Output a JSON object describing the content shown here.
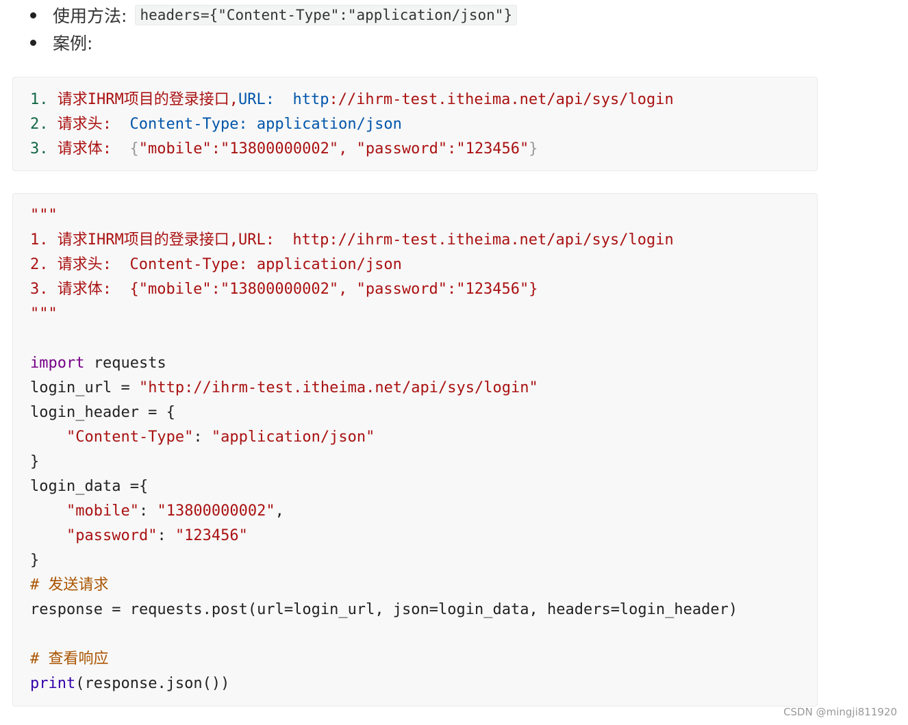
{
  "bullets": [
    {
      "label": "使用方法:",
      "code": "headers={\"Content-Type\":\"application/json\"}"
    },
    {
      "label": "案例:",
      "code": ""
    }
  ],
  "block1": {
    "lines": [
      [
        {
          "t": "1. ",
          "c": "num"
        },
        {
          "t": "请求IHRM项目的登录接口,",
          "c": "str"
        },
        {
          "t": "URL: ",
          "c": "meta"
        },
        {
          "t": " http",
          "c": "meta"
        },
        {
          "t": "://ihrm-test.itheima.net/api/sys/login",
          "c": "str"
        }
      ],
      [
        {
          "t": "2. ",
          "c": "num"
        },
        {
          "t": "请求头: ",
          "c": "str"
        },
        {
          "t": " Content-Type: application/json",
          "c": "meta"
        }
      ],
      [
        {
          "t": "3. ",
          "c": "num"
        },
        {
          "t": "请求体: ",
          "c": "str"
        },
        {
          "t": " {",
          "c": "punct"
        },
        {
          "t": "\"mobile\":\"13800000002\", \"password\":\"123456\"",
          "c": "str"
        },
        {
          "t": "}",
          "c": "punct"
        }
      ]
    ]
  },
  "block2": {
    "lines": [
      [
        {
          "t": "\"\"\"",
          "c": "str"
        }
      ],
      [
        {
          "t": "1. 请求IHRM项目的登录接口,URL:  http://ihrm-test.itheima.net/api/sys/login",
          "c": "str"
        }
      ],
      [
        {
          "t": "2. 请求头:  Content-Type: application/json",
          "c": "str"
        }
      ],
      [
        {
          "t": "3. 请求体:  {\"mobile\":\"13800000002\", \"password\":\"123456\"}",
          "c": "str"
        }
      ],
      [
        {
          "t": "\"\"\"",
          "c": "str"
        }
      ],
      [],
      [
        {
          "t": "import",
          "c": "kw"
        },
        {
          "t": " requests",
          "c": "default"
        }
      ],
      [
        {
          "t": "login_url = ",
          "c": "default"
        },
        {
          "t": "\"http://ihrm-test.itheima.net/api/sys/login\"",
          "c": "str"
        }
      ],
      [
        {
          "t": "login_header = {",
          "c": "default"
        }
      ],
      [
        {
          "t": "    ",
          "c": "default"
        },
        {
          "t": "\"Content-Type\"",
          "c": "str"
        },
        {
          "t": ": ",
          "c": "default"
        },
        {
          "t": "\"application/json\"",
          "c": "str"
        }
      ],
      [
        {
          "t": "}",
          "c": "default"
        }
      ],
      [
        {
          "t": "login_data ={",
          "c": "default"
        }
      ],
      [
        {
          "t": "    ",
          "c": "default"
        },
        {
          "t": "\"mobile\"",
          "c": "str"
        },
        {
          "t": ": ",
          "c": "default"
        },
        {
          "t": "\"13800000002\"",
          "c": "str"
        },
        {
          "t": ",",
          "c": "default"
        }
      ],
      [
        {
          "t": "    ",
          "c": "default"
        },
        {
          "t": "\"password\"",
          "c": "str"
        },
        {
          "t": ": ",
          "c": "default"
        },
        {
          "t": "\"123456\"",
          "c": "str"
        }
      ],
      [
        {
          "t": "}",
          "c": "default"
        }
      ],
      [
        {
          "t": "# 发送请求",
          "c": "comment"
        }
      ],
      [
        {
          "t": "response = requests.post(url=login_url, json=login_data, headers=login_header)",
          "c": "default"
        }
      ],
      [],
      [
        {
          "t": "# 查看响应",
          "c": "comment"
        }
      ],
      [
        {
          "t": "print",
          "c": "builtin"
        },
        {
          "t": "(response.json())",
          "c": "default"
        }
      ]
    ]
  },
  "watermark": "CSDN @mingji811920",
  "colors": {
    "num": "#116644",
    "str": "#aa1111",
    "kw": "#770088",
    "meta": "#0055aa",
    "punct": "#999999",
    "comment": "#aa5500",
    "builtin": "#3300aa",
    "default": "#222222"
  }
}
